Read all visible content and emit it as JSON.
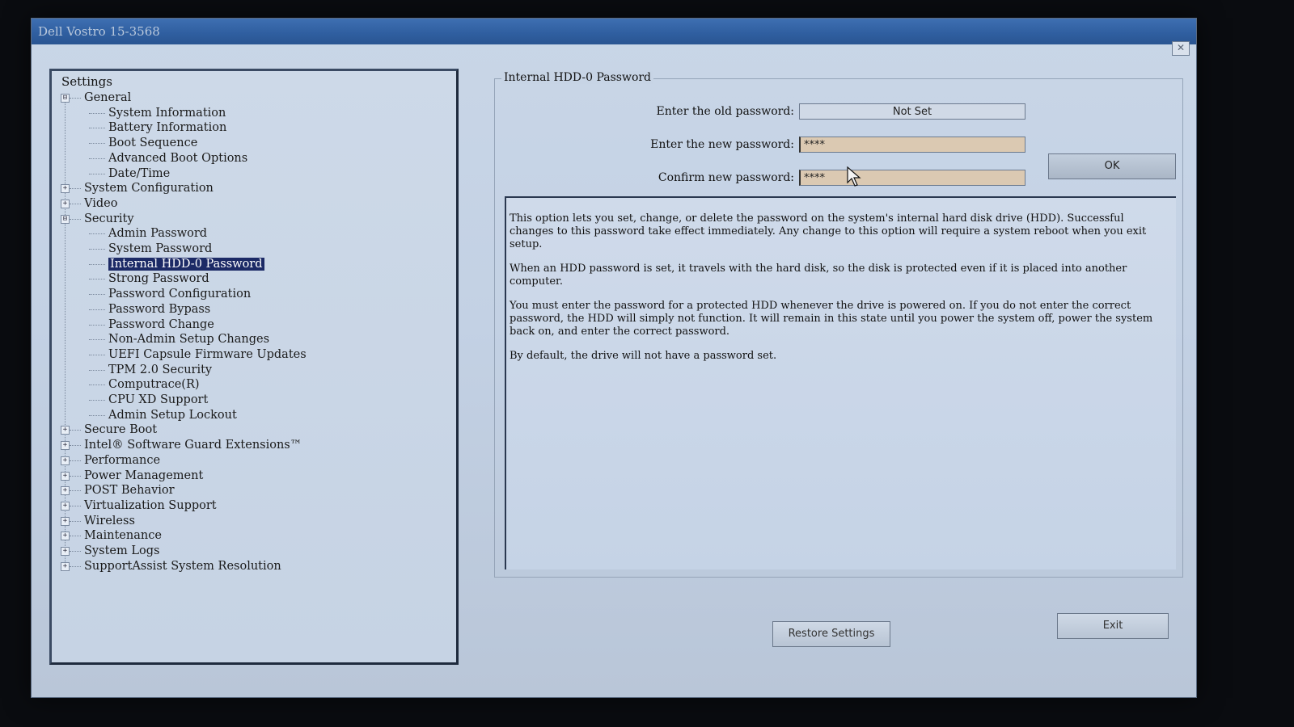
{
  "window": {
    "title": "Dell Vostro 15-3568",
    "close_glyph": "✕"
  },
  "tree": {
    "title": "Settings",
    "items": [
      {
        "label": "General",
        "level": 1,
        "toggle": "⊟"
      },
      {
        "label": "System Information",
        "level": 2
      },
      {
        "label": "Battery Information",
        "level": 2
      },
      {
        "label": "Boot Sequence",
        "level": 2
      },
      {
        "label": "Advanced Boot Options",
        "level": 2
      },
      {
        "label": "Date/Time",
        "level": 2
      },
      {
        "label": "System Configuration",
        "level": 1,
        "toggle": "+"
      },
      {
        "label": "Video",
        "level": 1,
        "toggle": "+"
      },
      {
        "label": "Security",
        "level": 1,
        "toggle": "⊟"
      },
      {
        "label": "Admin Password",
        "level": 2
      },
      {
        "label": "System Password",
        "level": 2
      },
      {
        "label": "Internal HDD-0 Password",
        "level": 2,
        "selected": true
      },
      {
        "label": "Strong Password",
        "level": 2
      },
      {
        "label": "Password Configuration",
        "level": 2
      },
      {
        "label": "Password Bypass",
        "level": 2
      },
      {
        "label": "Password Change",
        "level": 2
      },
      {
        "label": "Non-Admin Setup Changes",
        "level": 2
      },
      {
        "label": "UEFI Capsule Firmware Updates",
        "level": 2
      },
      {
        "label": "TPM 2.0 Security",
        "level": 2
      },
      {
        "label": "Computrace(R)",
        "level": 2
      },
      {
        "label": "CPU XD Support",
        "level": 2
      },
      {
        "label": "Admin Setup Lockout",
        "level": 2
      },
      {
        "label": "Secure Boot",
        "level": 1,
        "toggle": "+"
      },
      {
        "label": "Intel® Software Guard Extensions™",
        "level": 1,
        "toggle": "+"
      },
      {
        "label": "Performance",
        "level": 1,
        "toggle": "+"
      },
      {
        "label": "Power Management",
        "level": 1,
        "toggle": "+"
      },
      {
        "label": "POST Behavior",
        "level": 1,
        "toggle": "+"
      },
      {
        "label": "Virtualization Support",
        "level": 1,
        "toggle": "+"
      },
      {
        "label": "Wireless",
        "level": 1,
        "toggle": "+"
      },
      {
        "label": "Maintenance",
        "level": 1,
        "toggle": "+"
      },
      {
        "label": "System Logs",
        "level": 1,
        "toggle": "+"
      },
      {
        "label": "SupportAssist System Resolution",
        "level": 1,
        "toggle": "+"
      }
    ]
  },
  "content": {
    "section_title": "Internal HDD-0 Password",
    "old_password_label": "Enter the old password:",
    "old_password_value": "Not Set",
    "new_password_label": "Enter the new password:",
    "new_password_value": "****",
    "confirm_password_label": "Confirm new password:",
    "confirm_password_value": "****",
    "ok_label": "OK",
    "description": [
      "This option lets you set, change, or delete the password on the system's internal  hard disk drive (HDD). Successful changes to this password take effect immediately. Any change to this option will require a system reboot when you exit setup.",
      "When an HDD password is set, it travels with the hard disk, so the disk is protected even if it is placed into another computer.",
      "You must enter the password for a protected HDD whenever the drive is powered on.  If you do not enter the correct password, the HDD will simply not function. It will remain in this state until you power the system off, power the system back on, and enter the correct password.",
      "By default, the drive will not have a password set."
    ]
  },
  "buttons": {
    "restore_label": "Restore Settings",
    "exit_label": "Exit"
  },
  "colors": {
    "selection": "#1c2a66",
    "titlebar": "#2f5e9f",
    "entry_field": "#dbc9b2"
  }
}
